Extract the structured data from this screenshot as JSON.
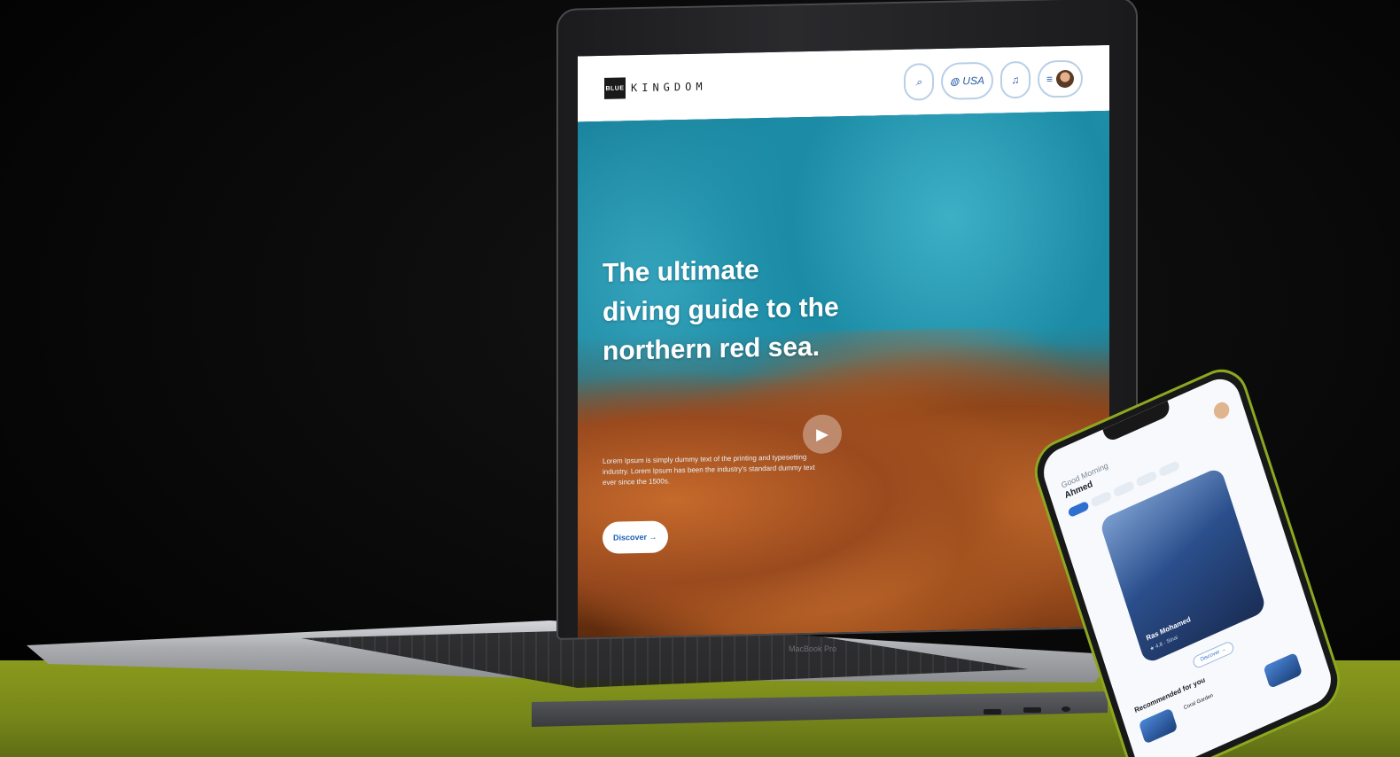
{
  "website": {
    "logo_mark": "BLUE",
    "logo_text": "KINGDOM",
    "nav": {
      "language": "USA"
    },
    "hero": {
      "title": "The ultimate diving guide to the northern red sea.",
      "description": "Lorem Ipsum is simply dummy text of the printing and typesetting industry. Lorem Ipsum has been the industry's standard dummy text ever since the 1500s.",
      "discover_label": "Discover →"
    }
  },
  "laptop": {
    "brand_label": "MacBook Pro"
  },
  "phone": {
    "greeting": "Good Morning",
    "name": "Ahmed",
    "card_title": "Ras Mohamed",
    "card_subtitle": "★ 4.8 · Sinai",
    "discover_label": "Discover →",
    "recommended_label": "Recommended for you",
    "thumb_label": "Coral Garden"
  },
  "colors": {
    "table": "#7f8f1b",
    "accent_blue": "#2f6fd0",
    "phone_frame": "#8da820"
  }
}
